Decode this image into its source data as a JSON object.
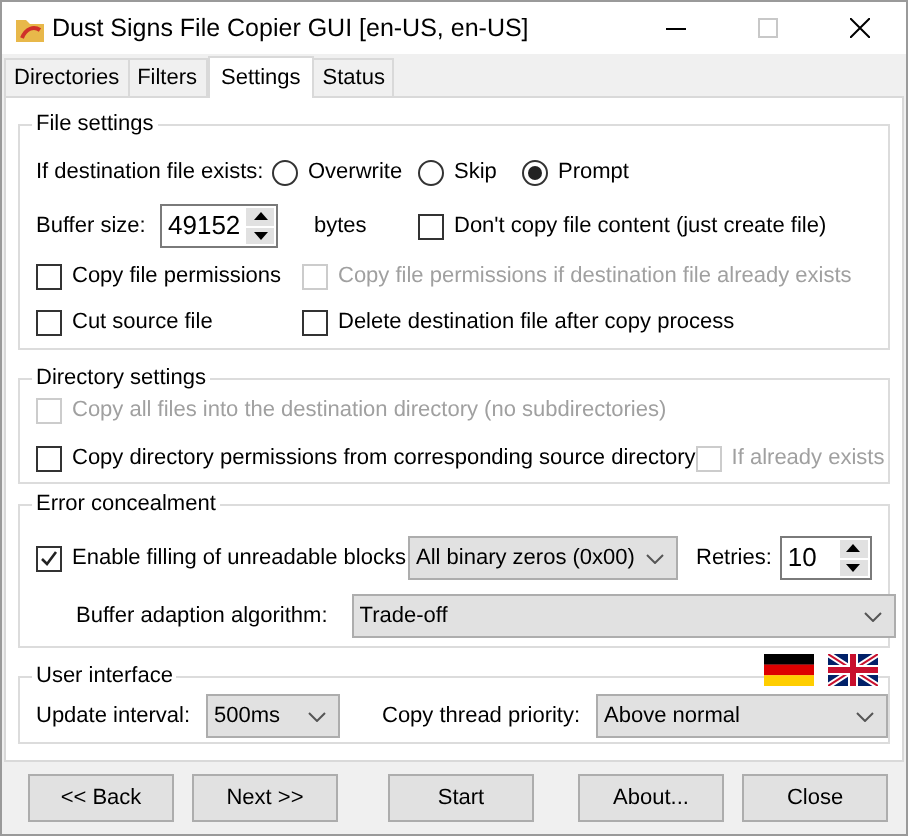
{
  "window": {
    "title": "Dust Signs File Copier GUI [en-US, en-US]"
  },
  "tabs": [
    {
      "label": "Directories",
      "selected": false
    },
    {
      "label": "Filters",
      "selected": false
    },
    {
      "label": "Settings",
      "selected": true
    },
    {
      "label": "Status",
      "selected": false
    }
  ],
  "file_settings": {
    "title": "File settings",
    "exists_label": "If destination file exists:",
    "exists_options": [
      {
        "label": "Overwrite",
        "selected": false
      },
      {
        "label": "Skip",
        "selected": false
      },
      {
        "label": "Prompt",
        "selected": true
      }
    ],
    "buffer_label": "Buffer size:",
    "buffer_value": "49152",
    "buffer_unit": "bytes",
    "checkboxes": [
      {
        "label": "Don't copy file content (just create file)",
        "checked": false,
        "disabled": false
      },
      {
        "label": "Copy file permissions",
        "checked": false,
        "disabled": false
      },
      {
        "label": "Copy file permissions if destination file already exists",
        "checked": false,
        "disabled": true
      },
      {
        "label": "Cut source file",
        "checked": false,
        "disabled": false
      },
      {
        "label": "Delete destination file after copy process",
        "checked": false,
        "disabled": false
      }
    ]
  },
  "directory_settings": {
    "title": "Directory settings",
    "checkboxes": [
      {
        "label": "Copy all files into the destination directory (no subdirectories)",
        "checked": false,
        "disabled": true
      },
      {
        "label": "Copy directory permissions from corresponding source directory",
        "checked": false,
        "disabled": false
      },
      {
        "label": "If already exists",
        "checked": false,
        "disabled": true
      }
    ]
  },
  "error_concealment": {
    "title": "Error concealment",
    "fill_checkbox": {
      "label": "Enable filling of unreadable blocks",
      "checked": true,
      "disabled": false
    },
    "fill_value": "All binary zeros (0x00)",
    "retries_label": "Retries:",
    "retries_value": "10",
    "algorithm_label": "Buffer adaption algorithm:",
    "algorithm_value": "Trade-off"
  },
  "user_interface": {
    "title": "User interface",
    "interval_label": "Update interval:",
    "interval_value": "500ms",
    "priority_label": "Copy thread priority:",
    "priority_value": "Above normal"
  },
  "buttons": [
    "<< Back",
    "Next >>",
    "Start",
    "About...",
    "Close"
  ]
}
